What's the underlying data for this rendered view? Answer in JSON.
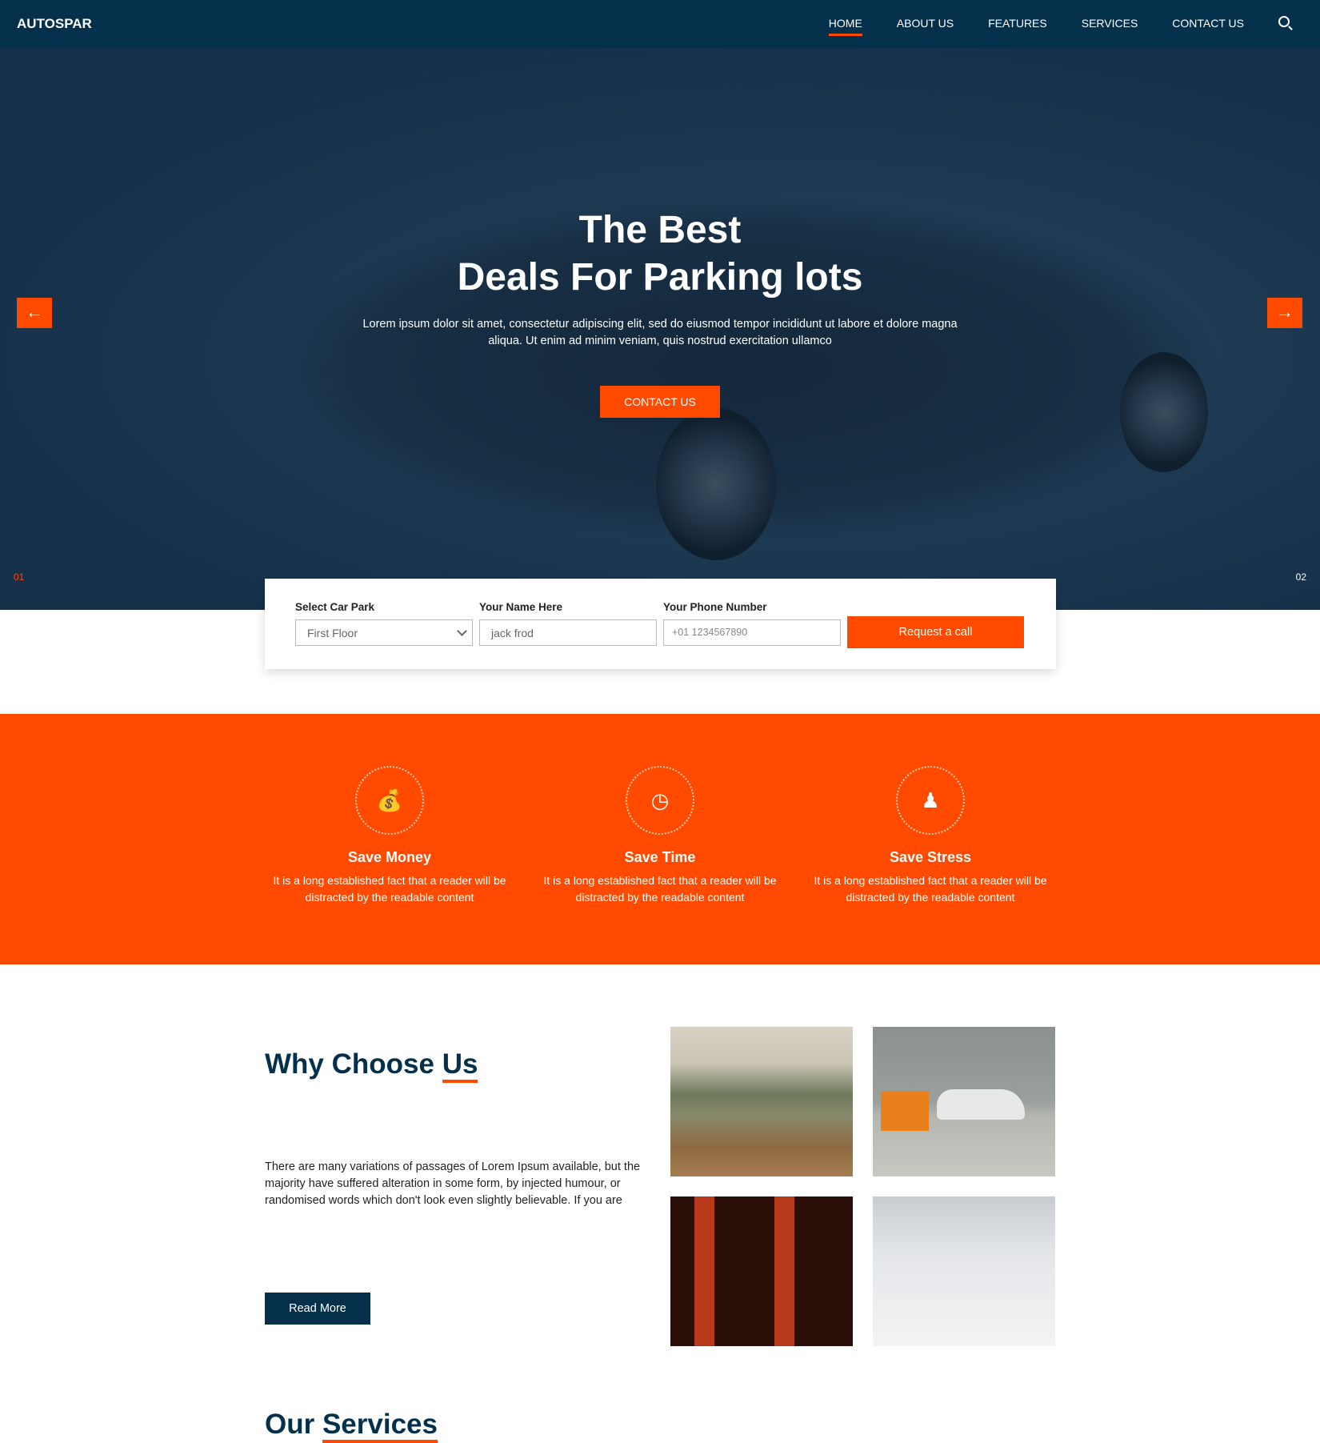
{
  "nav": {
    "logo": "AUTOSPAR",
    "items": [
      "HOME",
      "ABOUT US",
      "FEATURES",
      "SERVICES",
      "CONTACT US"
    ],
    "active": "HOME"
  },
  "hero": {
    "title_line1": "The Best",
    "title_line2": "Deals For Parking lots",
    "text": "Lorem ipsum dolor sit amet, consectetur adipiscing elit, sed do eiusmod tempor incididunt ut labore et dolore magna aliqua. Ut enim ad minim veniam, quis nostrud exercitation ullamco",
    "button": "CONTACT US",
    "prev_slide": "01",
    "next_slide": "02",
    "prev_arrow": "←",
    "next_arrow": "→"
  },
  "form": {
    "car_park_label": "Select Car Park",
    "car_park_value": "First Floor",
    "name_label": "Your Name Here",
    "name_placeholder": "jack frod",
    "phone_label": "Your Phone Number",
    "phone_placeholder": "+01 1234567890",
    "submit": "Request a call"
  },
  "features": [
    {
      "icon": "money-bag-icon",
      "title": "Save Money",
      "text": "It is a long established fact that a reader will be distracted by the readable content"
    },
    {
      "icon": "clock-icon",
      "title": "Save Time",
      "text": "It is a long established fact that a reader will be distracted by the readable content"
    },
    {
      "icon": "person-pin-icon",
      "title": "Save Stress",
      "text": "It is a long established fact that a reader will be distracted by the readable content"
    }
  ],
  "why": {
    "title_a": "Why Choose ",
    "title_b": "Us",
    "text": "There are many variations of passages of Lorem Ipsum available, but the majority have suffered alteration in some form, by injected humour, or randomised words which don't look even slightly believable. If you are",
    "button": "Read More"
  },
  "services": {
    "title_a": "Our ",
    "title_b": "Services"
  },
  "colors": {
    "navy": "#04304b",
    "accent": "#ff4a00"
  }
}
